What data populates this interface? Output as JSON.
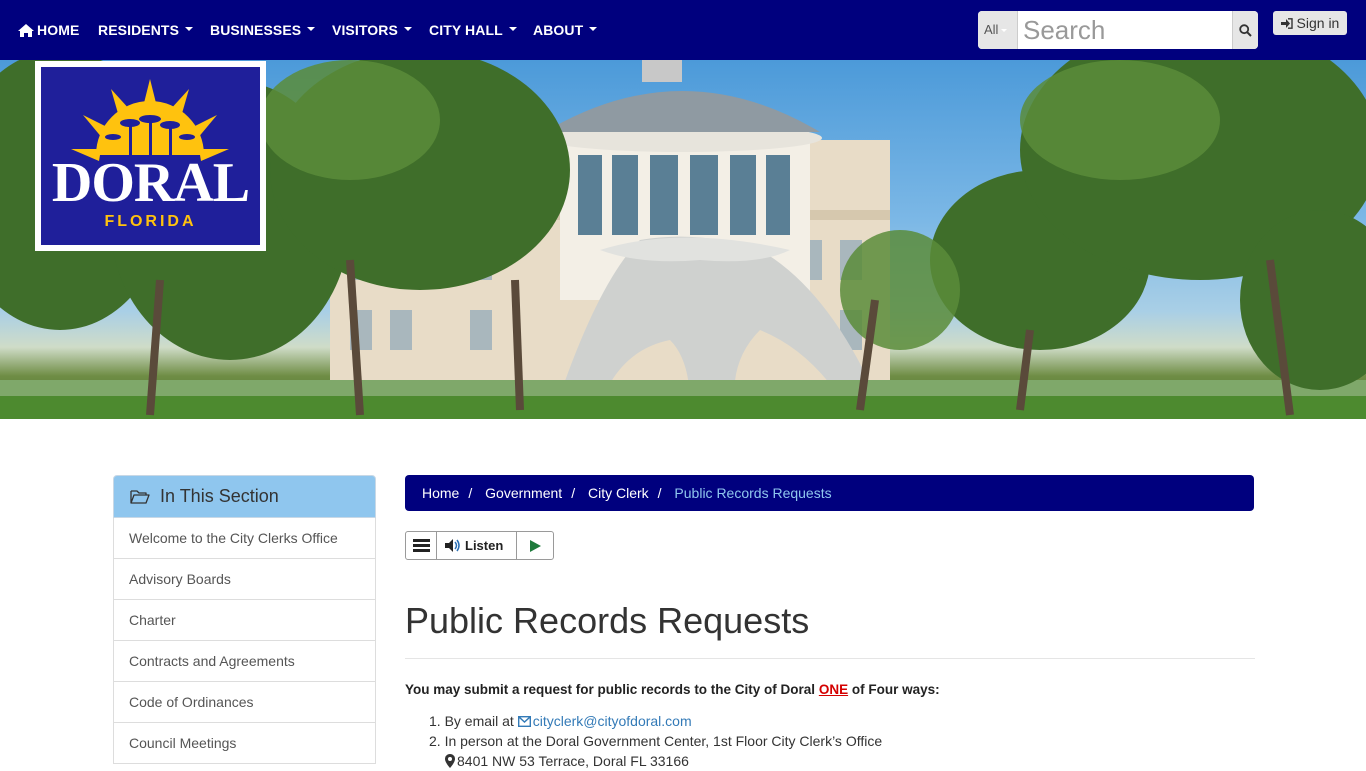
{
  "nav": {
    "home": "HOME",
    "items": [
      "RESIDENTS",
      "BUSINESSES",
      "VISITORS",
      "CITY HALL",
      "ABOUT"
    ]
  },
  "search": {
    "scope": "All",
    "placeholder": "Search"
  },
  "signin": "Sign in",
  "logo": {
    "name": "DORAL",
    "state": "FLORIDA"
  },
  "sidebar": {
    "title": "In This Section",
    "items": [
      "Welcome to the City Clerks Office",
      "Advisory Boards",
      "Charter",
      "Contracts and Agreements",
      "Code of Ordinances",
      "Council Meetings"
    ]
  },
  "breadcrumb": {
    "items": [
      "Home",
      "Government",
      "City Clerk"
    ],
    "current": "Public Records Requests"
  },
  "listen": {
    "label": "Listen"
  },
  "main": {
    "title": "Public Records Requests",
    "intro_before": "You may submit a request for public records to the City of Doral ",
    "intro_emphasis": "ONE",
    "intro_after": " of Four ways:",
    "ways": [
      {
        "num": "1.",
        "text": "By email at ",
        "link": "cityclerk@cityofdoral.com"
      },
      {
        "num": "2.",
        "text": "In person at the Doral Government Center, 1st Floor City Clerk’s Office",
        "address": "8401 NW 53 Terrace, Doral FL 33166"
      }
    ]
  },
  "colors": {
    "nav_bg": "#00007e",
    "sidebar_head": "#8fc6ee",
    "accent_red": "#d40000",
    "link": "#337ab7"
  }
}
